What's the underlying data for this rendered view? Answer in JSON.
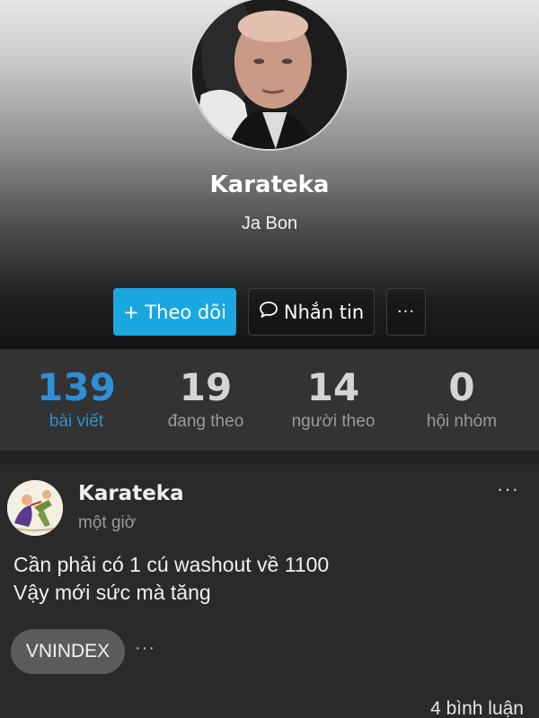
{
  "profile": {
    "display_name": "Karateka",
    "username": "Ja Bon",
    "follow_label": "+ Theo dõi",
    "message_label": "Nhắn tin",
    "more_label": "···"
  },
  "stats": [
    {
      "value": "139",
      "label": "bài viết",
      "active": true
    },
    {
      "value": "19",
      "label": "đang theo",
      "active": false
    },
    {
      "value": "14",
      "label": "người theo",
      "active": false
    },
    {
      "value": "0",
      "label": "hội nhóm",
      "active": false
    }
  ],
  "post": {
    "author": "Karateka",
    "time": "một giờ",
    "menu_label": "···",
    "lines": [
      "Cần phải có 1 cú washout về 1100",
      "Vậy mới sức mà tăng"
    ],
    "tag": "VNINDEX",
    "tag_more": "···",
    "comments": "4 bình luận"
  },
  "colors": {
    "accent": "#1aa7e0",
    "active_stat": "#2f8fd6",
    "background": "#232323"
  }
}
